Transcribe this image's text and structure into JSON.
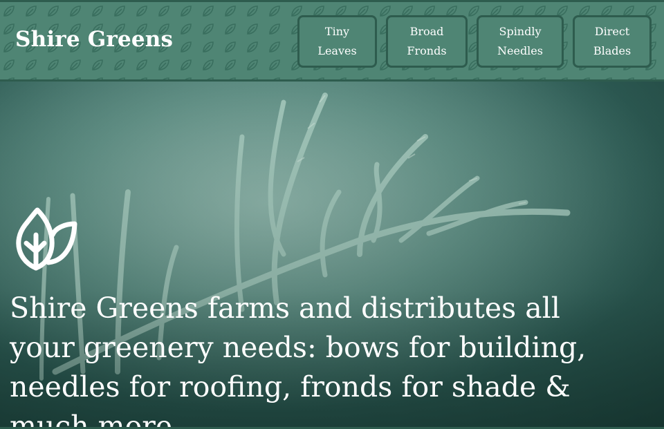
{
  "header": {
    "brand": "Shire Greens",
    "nav": [
      {
        "line1": "Tiny",
        "line2": "Leaves"
      },
      {
        "line1": "Broad",
        "line2": "Fronds"
      },
      {
        "line1": "Spindly",
        "line2": "Needles"
      },
      {
        "line1": "Direct",
        "line2": "Blades"
      }
    ]
  },
  "hero": {
    "logo_icon": "leaf-icon",
    "text": "Shire Greens farms and distributes all your greenery needs: bows for building, needles for roofing, fronds for shade & much more."
  },
  "colors": {
    "header_bg": "#4f8574",
    "border": "#2e5c4e",
    "text": "#ffffff"
  }
}
